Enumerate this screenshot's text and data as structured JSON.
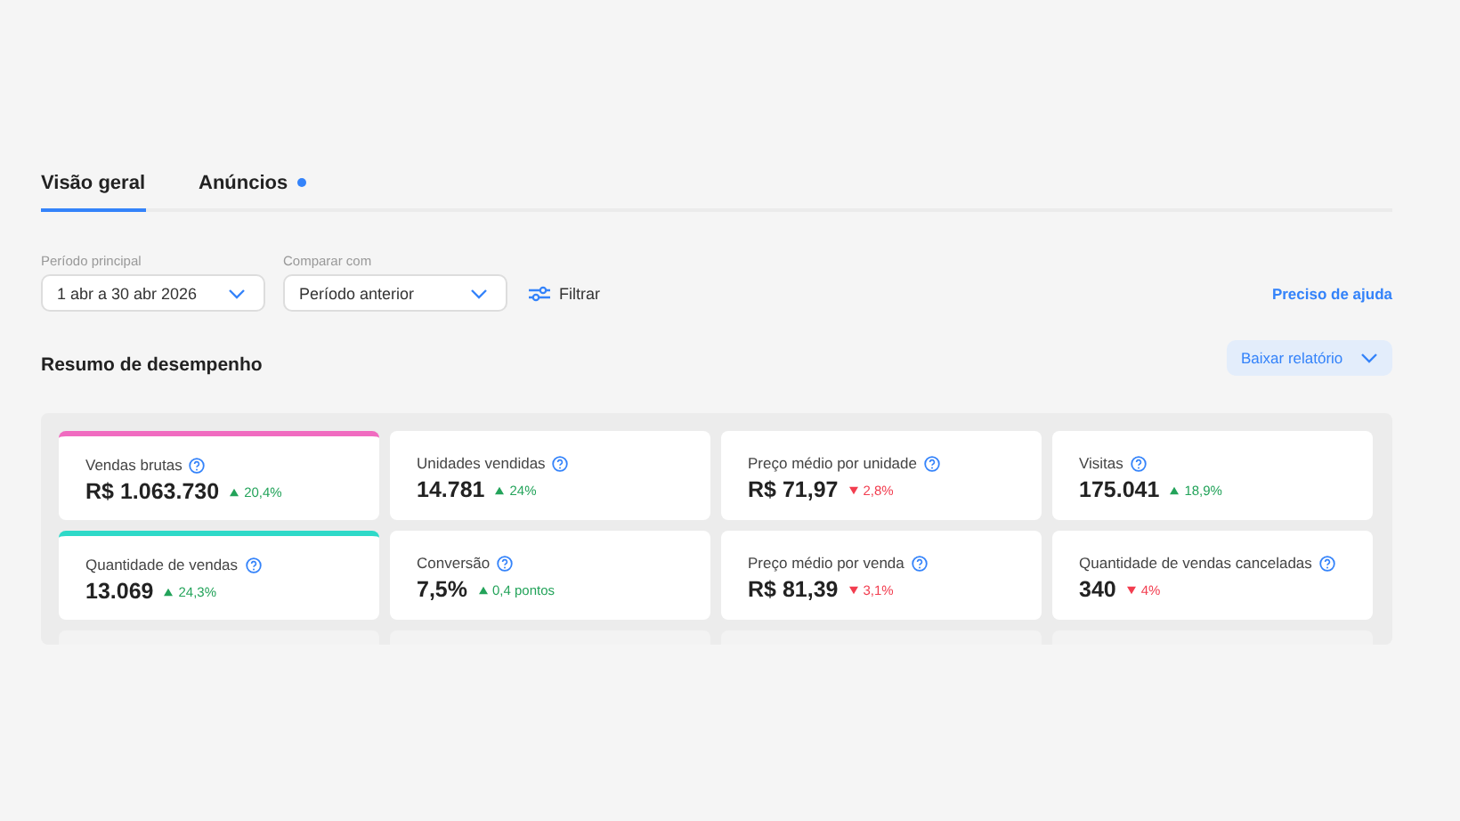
{
  "tabs": [
    {
      "label": "Visão geral",
      "selected": true,
      "dot": false
    },
    {
      "label": "Anúncios",
      "selected": false,
      "dot": true
    }
  ],
  "filters": [
    {
      "label": "Período principal",
      "value": "1 abr a 30 abr 2026"
    },
    {
      "label": "Comparar com",
      "value": "Período anterior"
    }
  ],
  "filter_button": "Filtrar",
  "help_link": "Preciso de ajuda",
  "section_title": "Resumo de desempenho",
  "report_button": "Baixar relatório",
  "metrics": [
    {
      "label": "Vendas brutas",
      "value": "R$ 1.063.730",
      "rising": true,
      "change": "20,4%",
      "color": "#f06bc0"
    },
    {
      "label": "Unidades vendidas",
      "value": "14.781",
      "rising": true,
      "change": "24%"
    },
    {
      "label": "Preço médio por unidade",
      "value": "R$ 71,97",
      "rising": false,
      "change": "2,8%"
    },
    {
      "label": "Visitas",
      "value": "175.041",
      "rising": true,
      "change": "18,9%"
    },
    {
      "label": "Quantidade de vendas",
      "value": "13.069",
      "rising": true,
      "change": "24,3%",
      "color": "#2ed9c8"
    },
    {
      "label": "Conversão",
      "value": "7,5%",
      "rising": true,
      "change": "0,4 pontos"
    },
    {
      "label": "Preço médio por venda",
      "value": "R$ 81,39",
      "rising": false,
      "change": "3,1%"
    },
    {
      "label": "Quantidade de vendas canceladas",
      "value": "340",
      "rising": false,
      "change": "4%"
    }
  ]
}
